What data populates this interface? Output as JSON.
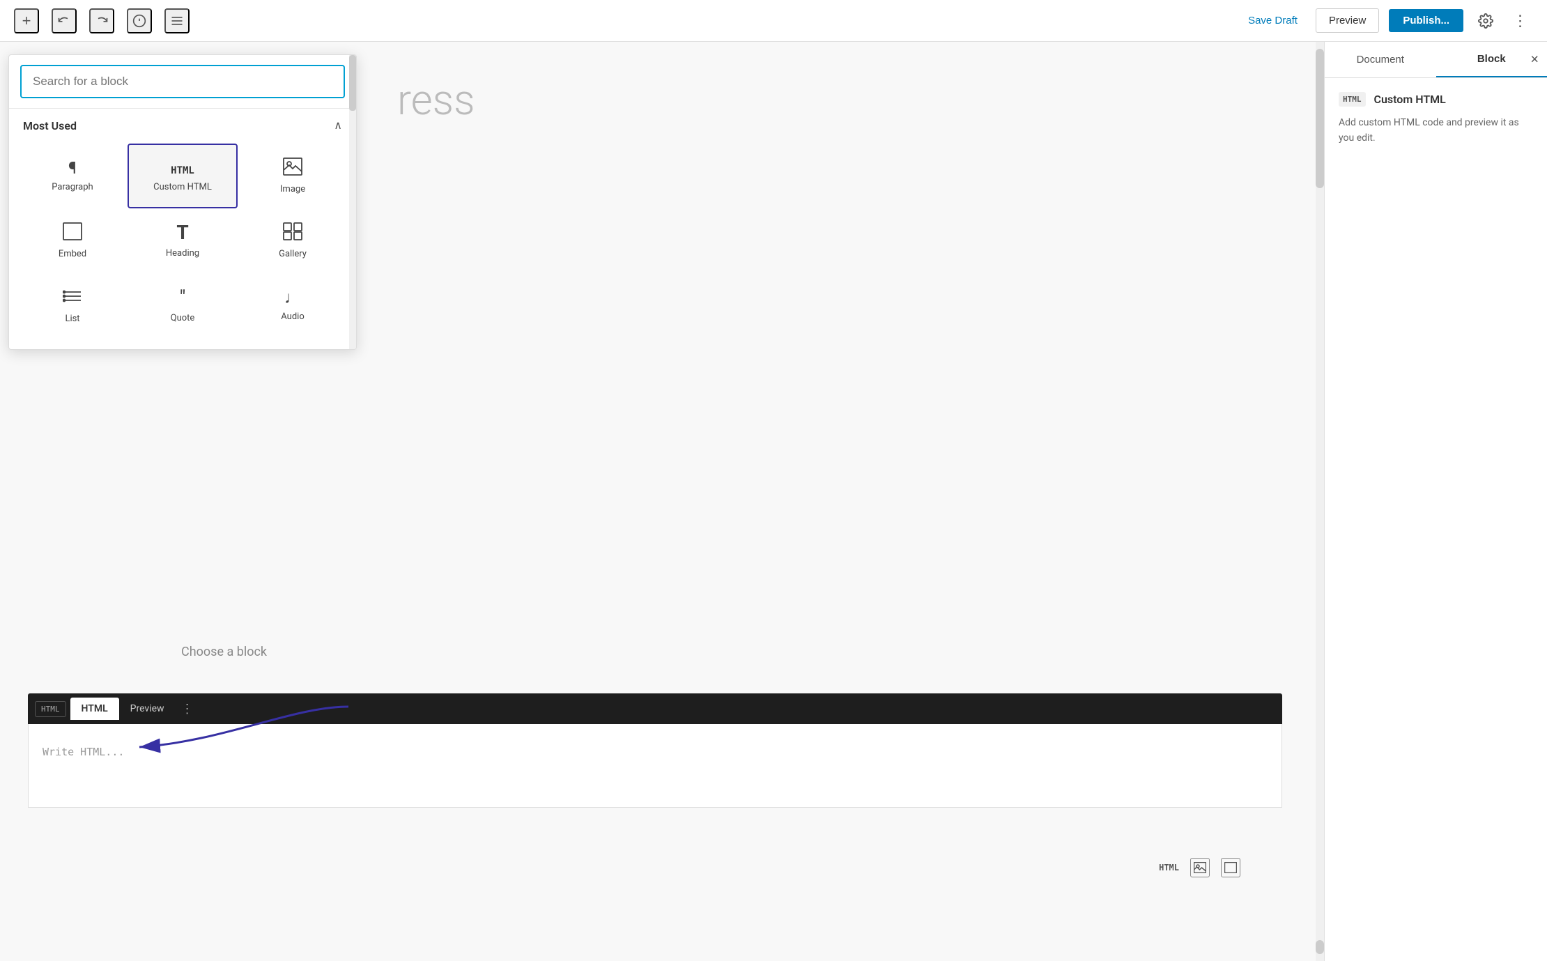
{
  "toolbar": {
    "save_draft_label": "Save Draft",
    "preview_label": "Preview",
    "publish_label": "Publish...",
    "add_icon": "+",
    "undo_icon": "↩",
    "redo_icon": "↪",
    "info_icon": "ℹ",
    "list_icon": "≡",
    "settings_icon": "⚙",
    "more_icon": "⋮"
  },
  "block_inserter": {
    "search_placeholder": "Search for a block",
    "section_title": "Most Used",
    "collapse_icon": "∧",
    "blocks": [
      {
        "id": "paragraph",
        "label": "Paragraph",
        "icon": "¶",
        "type": "text",
        "selected": false
      },
      {
        "id": "custom-html",
        "label": "Custom HTML",
        "icon": "HTML",
        "type": "html",
        "selected": true
      },
      {
        "id": "image",
        "label": "Image",
        "icon": "🖼",
        "type": "text",
        "selected": false
      },
      {
        "id": "embed",
        "label": "Embed",
        "icon": "□",
        "type": "text",
        "selected": false
      },
      {
        "id": "heading",
        "label": "Heading",
        "icon": "T",
        "type": "text",
        "selected": false
      },
      {
        "id": "gallery",
        "label": "Gallery",
        "icon": "⊞",
        "type": "text",
        "selected": false
      },
      {
        "id": "list",
        "label": "List",
        "icon": "☰",
        "type": "text",
        "selected": false
      },
      {
        "id": "quote",
        "label": "Quote",
        "icon": "❝",
        "type": "text",
        "selected": false
      },
      {
        "id": "audio",
        "label": "Audio",
        "icon": "♩",
        "type": "text",
        "selected": false
      }
    ]
  },
  "editor": {
    "title_placeholder": "ress",
    "choose_block_text": "Choose a block",
    "html_editor_placeholder": "Write HTML...",
    "html_tab_label": "HTML",
    "preview_tab_label": "Preview",
    "html_tag": "HTML"
  },
  "sidebar": {
    "document_tab": "Document",
    "block_tab": "Block",
    "close_icon": "×",
    "block_info": {
      "icon": "HTML",
      "title": "Custom HTML",
      "description": "Add custom HTML code and preview it as you edit."
    }
  },
  "bottom_toolbar": {
    "html_label": "HTML"
  }
}
